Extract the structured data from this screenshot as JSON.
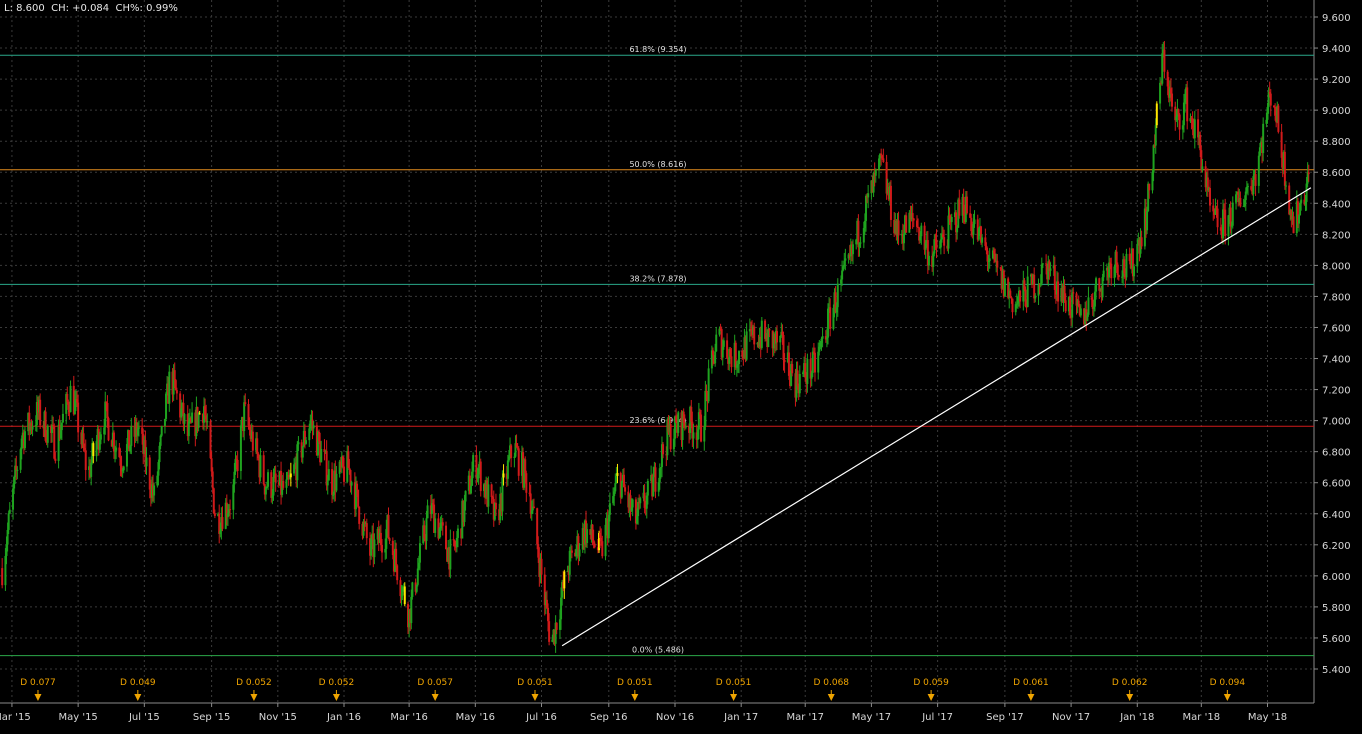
{
  "status_line": "L: 8.600  CH: +0.084  CH%: 0.99%",
  "colors": {
    "background": "#000000",
    "grid": "#3a3a3a",
    "axis_text": "#d8d8d8",
    "up": "#1fa31f",
    "down": "#d11a1a",
    "highlight": "#ffe600",
    "fib_0": "#2ba84a",
    "fib_236": "#d11a1a",
    "fib_382": "#2aa88a",
    "fib_500": "#e08a1e",
    "fib_618": "#2aa88a",
    "trendline": "#ffffff",
    "dividend": "#f0a500"
  },
  "chart_data": {
    "type": "candlestick",
    "x_ticks": [
      "Mar '15",
      "May '15",
      "Jul '15",
      "Sep '15",
      "Nov '15",
      "Jan '16",
      "Mar '16",
      "May '16",
      "Jul '16",
      "Sep '16",
      "Nov '16",
      "Jan '17",
      "Mar '17",
      "May '17",
      "Jul '17",
      "Sep '17",
      "Nov '17",
      "Jan '18",
      "Mar '18",
      "May '18"
    ],
    "y_ticks": [
      "9.600",
      "9.400",
      "9.200",
      "9.000",
      "8.800",
      "8.600",
      "8.400",
      "8.200",
      "8.000",
      "7.800",
      "7.600",
      "7.400",
      "7.200",
      "7.000",
      "6.800",
      "6.600",
      "6.400",
      "6.200",
      "6.000",
      "5.800",
      "5.600",
      "5.400"
    ],
    "ylim": [
      5.4,
      9.6
    ],
    "grid": true,
    "last": 8.6,
    "change": 0.084,
    "change_pct": 0.99,
    "price_path": [
      {
        "date": "2015-02-20",
        "price": 6.05
      },
      {
        "date": "2015-03-10",
        "price": 6.9
      },
      {
        "date": "2015-03-25",
        "price": 7.05
      },
      {
        "date": "2015-04-10",
        "price": 6.85
      },
      {
        "date": "2015-04-25",
        "price": 7.2
      },
      {
        "date": "2015-05-10",
        "price": 6.65
      },
      {
        "date": "2015-05-25",
        "price": 7.05
      },
      {
        "date": "2015-06-10",
        "price": 6.75
      },
      {
        "date": "2015-06-25",
        "price": 6.95
      },
      {
        "date": "2015-07-10",
        "price": 6.5
      },
      {
        "date": "2015-07-25",
        "price": 7.3
      },
      {
        "date": "2015-08-10",
        "price": 6.9
      },
      {
        "date": "2015-08-25",
        "price": 7.1
      },
      {
        "date": "2015-09-05",
        "price": 6.35
      },
      {
        "date": "2015-09-20",
        "price": 6.5
      },
      {
        "date": "2015-10-01",
        "price": 7.05
      },
      {
        "date": "2015-10-20",
        "price": 6.6
      },
      {
        "date": "2015-11-10",
        "price": 6.55
      },
      {
        "date": "2015-12-01",
        "price": 7.0
      },
      {
        "date": "2015-12-20",
        "price": 6.6
      },
      {
        "date": "2016-01-05",
        "price": 6.7
      },
      {
        "date": "2016-01-25",
        "price": 6.15
      },
      {
        "date": "2016-02-10",
        "price": 6.3
      },
      {
        "date": "2016-03-01",
        "price": 5.75
      },
      {
        "date": "2016-03-20",
        "price": 6.45
      },
      {
        "date": "2016-04-10",
        "price": 6.1
      },
      {
        "date": "2016-05-01",
        "price": 6.75
      },
      {
        "date": "2016-05-20",
        "price": 6.35
      },
      {
        "date": "2016-06-05",
        "price": 6.85
      },
      {
        "date": "2016-06-20",
        "price": 6.55
      },
      {
        "date": "2016-07-01",
        "price": 6.0
      },
      {
        "date": "2016-07-10",
        "price": 5.55
      },
      {
        "date": "2016-07-25",
        "price": 6.05
      },
      {
        "date": "2016-08-10",
        "price": 6.3
      },
      {
        "date": "2016-08-25",
        "price": 6.15
      },
      {
        "date": "2016-09-10",
        "price": 6.65
      },
      {
        "date": "2016-09-25",
        "price": 6.35
      },
      {
        "date": "2016-10-10",
        "price": 6.55
      },
      {
        "date": "2016-10-25",
        "price": 6.9
      },
      {
        "date": "2016-11-10",
        "price": 7.0
      },
      {
        "date": "2016-11-25",
        "price": 6.95
      },
      {
        "date": "2016-12-10",
        "price": 7.55
      },
      {
        "date": "2016-12-25",
        "price": 7.4
      },
      {
        "date": "2017-01-15",
        "price": 7.55
      },
      {
        "date": "2017-02-05",
        "price": 7.5
      },
      {
        "date": "2017-02-20",
        "price": 7.25
      },
      {
        "date": "2017-03-10",
        "price": 7.35
      },
      {
        "date": "2017-03-25",
        "price": 7.7
      },
      {
        "date": "2017-04-10",
        "price": 8.0
      },
      {
        "date": "2017-04-25",
        "price": 8.35
      },
      {
        "date": "2017-05-10",
        "price": 8.65
      },
      {
        "date": "2017-05-25",
        "price": 8.2
      },
      {
        "date": "2017-06-10",
        "price": 8.3
      },
      {
        "date": "2017-06-25",
        "price": 8.05
      },
      {
        "date": "2017-07-10",
        "price": 8.2
      },
      {
        "date": "2017-07-25",
        "price": 8.4
      },
      {
        "date": "2017-08-10",
        "price": 8.15
      },
      {
        "date": "2017-08-25",
        "price": 7.95
      },
      {
        "date": "2017-09-10",
        "price": 7.75
      },
      {
        "date": "2017-09-25",
        "price": 7.85
      },
      {
        "date": "2017-10-10",
        "price": 8.0
      },
      {
        "date": "2017-10-25",
        "price": 7.8
      },
      {
        "date": "2017-11-10",
        "price": 7.65
      },
      {
        "date": "2017-11-25",
        "price": 7.85
      },
      {
        "date": "2017-12-10",
        "price": 8.05
      },
      {
        "date": "2017-12-25",
        "price": 7.95
      },
      {
        "date": "2018-01-10",
        "price": 8.35
      },
      {
        "date": "2018-01-25",
        "price": 9.35
      },
      {
        "date": "2018-02-05",
        "price": 8.9
      },
      {
        "date": "2018-02-15",
        "price": 9.05
      },
      {
        "date": "2018-02-28",
        "price": 8.75
      },
      {
        "date": "2018-03-10",
        "price": 8.3
      },
      {
        "date": "2018-03-20",
        "price": 8.25
      },
      {
        "date": "2018-04-05",
        "price": 8.4
      },
      {
        "date": "2018-04-20",
        "price": 8.6
      },
      {
        "date": "2018-05-05",
        "price": 9.15
      },
      {
        "date": "2018-05-15",
        "price": 8.7
      },
      {
        "date": "2018-05-25",
        "price": 8.25
      },
      {
        "date": "2018-06-05",
        "price": 8.5
      },
      {
        "date": "2018-06-10",
        "price": 8.6
      }
    ],
    "fib_levels": [
      {
        "key": "fib_618",
        "label": "61.8% (9.354)",
        "value": 9.354
      },
      {
        "key": "fib_500",
        "label": "50.0% (8.616)",
        "value": 8.616
      },
      {
        "key": "fib_382",
        "label": "38.2% (7.878)",
        "value": 7.878
      },
      {
        "key": "fib_236",
        "label": "23.6% (6.964)",
        "value": 6.964
      },
      {
        "key": "fib_0",
        "label": "0.0% (5.486)",
        "value": 5.486
      }
    ],
    "trendline": [
      {
        "date": "2016-07-20",
        "price": 5.55
      },
      {
        "date": "2018-06-10",
        "price": 8.5
      }
    ],
    "dividends": [
      {
        "date": "2015-03-25",
        "label": "D 0.077"
      },
      {
        "date": "2015-06-25",
        "label": "D 0.049"
      },
      {
        "date": "2015-10-10",
        "label": "D 0.052"
      },
      {
        "date": "2015-12-25",
        "label": "D 0.052"
      },
      {
        "date": "2016-03-25",
        "label": "D 0.057"
      },
      {
        "date": "2016-06-25",
        "label": "D 0.051"
      },
      {
        "date": "2016-09-25",
        "label": "D 0.051"
      },
      {
        "date": "2016-12-25",
        "label": "D 0.051"
      },
      {
        "date": "2017-03-25",
        "label": "D 0.068"
      },
      {
        "date": "2017-06-25",
        "label": "D 0.059"
      },
      {
        "date": "2017-09-25",
        "label": "D 0.061"
      },
      {
        "date": "2017-12-25",
        "label": "D 0.062"
      },
      {
        "date": "2018-03-25",
        "label": "D 0.094"
      }
    ]
  }
}
